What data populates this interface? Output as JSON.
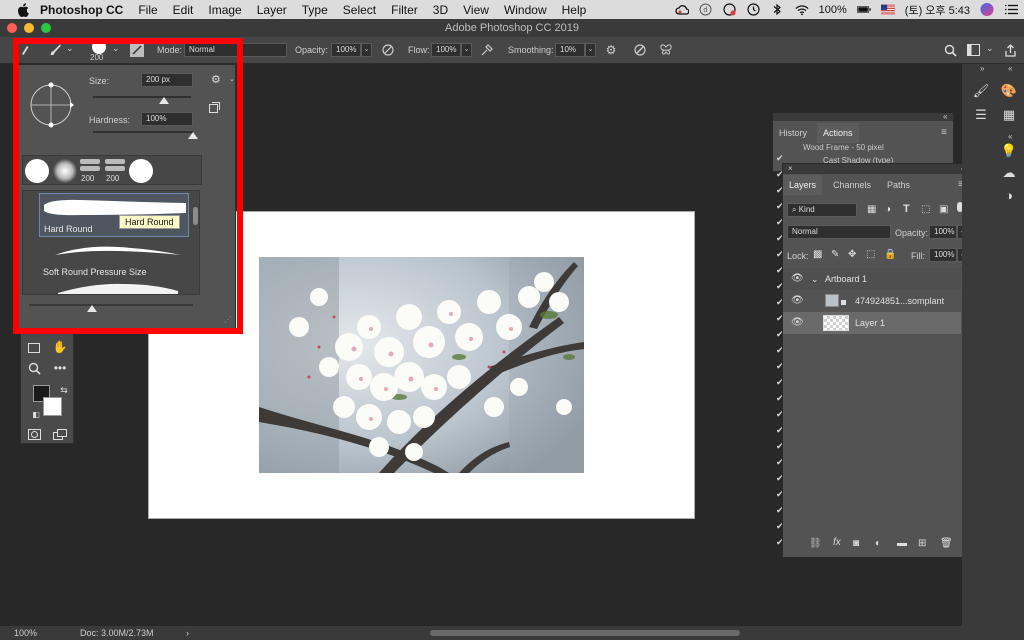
{
  "menubar": {
    "app_name": "Photoshop CC",
    "items": [
      "File",
      "Edit",
      "Image",
      "Layer",
      "Type",
      "Select",
      "Filter",
      "3D",
      "View",
      "Window",
      "Help"
    ],
    "battery": "100%",
    "clock": "(토) 오후 5:43"
  },
  "window": {
    "title": "Adobe Photoshop CC 2019"
  },
  "options": {
    "brush_size_badge": "200",
    "mode_label": "Mode:",
    "mode_value": "Normal",
    "opacity_label": "Opacity:",
    "opacity_value": "100%",
    "flow_label": "Flow:",
    "flow_value": "100%",
    "smoothing_label": "Smoothing:",
    "smoothing_value": "10%"
  },
  "brush_popup": {
    "size_label": "Size:",
    "size_value": "200 px",
    "size_level": 0.72,
    "hardness_label": "Hardness:",
    "hardness_value": "100%",
    "hardness_level": 1.0,
    "recent_sizes": [
      "200",
      "200"
    ],
    "presets": [
      {
        "name": "Hard Round"
      },
      {
        "name": "Soft Round Pressure Size"
      }
    ],
    "tooltip": "Hard Round"
  },
  "history_panel": {
    "tabs": [
      "History",
      "Actions"
    ],
    "active_tab": "Actions",
    "rows": [
      "Wood Frame - 50 pixel",
      "Cast Shadow (type)"
    ]
  },
  "layers_panel": {
    "tabs": [
      "Layers",
      "Channels",
      "Paths"
    ],
    "active_tab": "Layers",
    "filter_kind": "Kind",
    "blend_mode": "Normal",
    "opacity_label": "Opacity:",
    "opacity_value": "100%",
    "lock_label": "Lock:",
    "fill_label": "Fill:",
    "fill_value": "100%",
    "layers": [
      {
        "name": "Artboard 1",
        "type": "group"
      },
      {
        "name": "474924851...somplant",
        "type": "smart"
      },
      {
        "name": "Layer 1",
        "type": "pixel",
        "selected": true
      }
    ]
  },
  "status": {
    "zoom": "100%",
    "doc": "Doc: 3.00M/2.73M"
  }
}
